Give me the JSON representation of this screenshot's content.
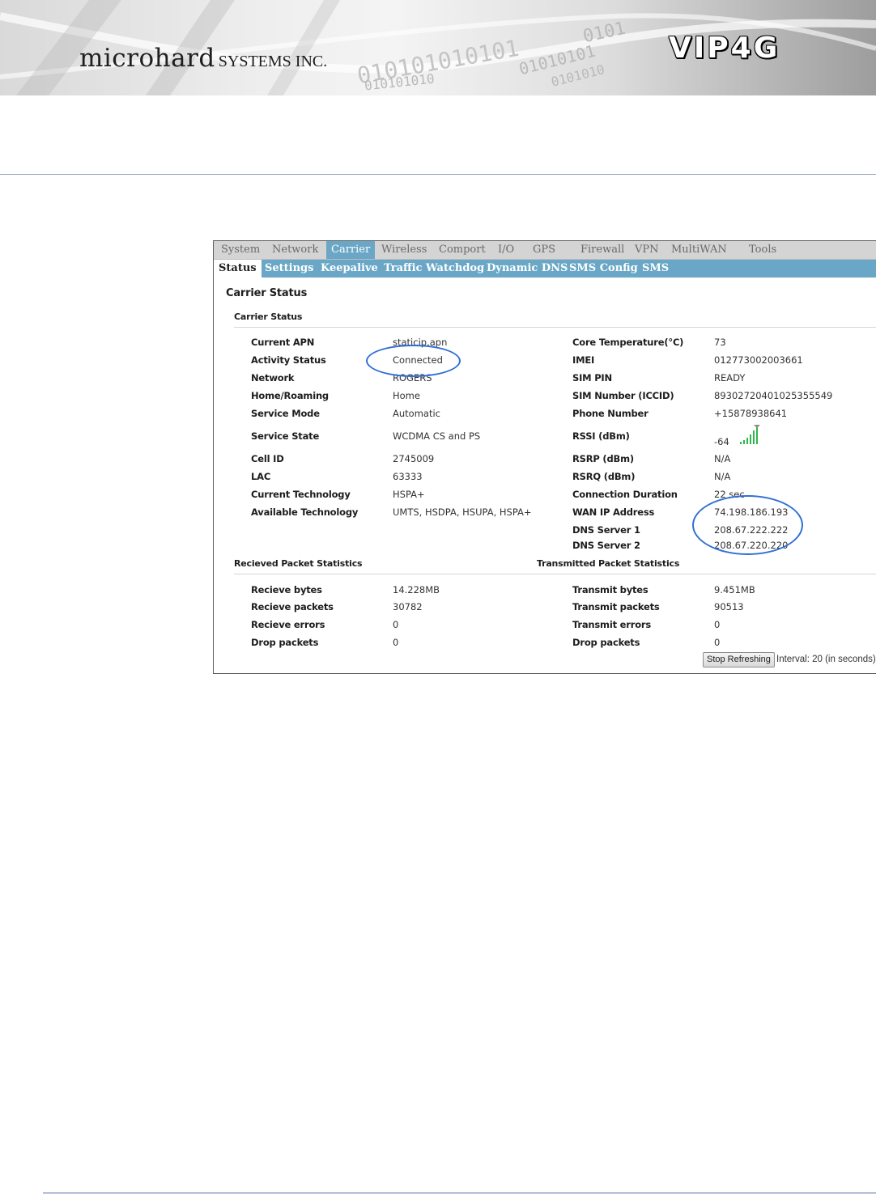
{
  "banner": {
    "company_name": "microhard",
    "company_suffix": "SYSTEMS INC.",
    "product": "VIP4G",
    "binary_lines": [
      "0101",
      "010101010101",
      "01010101",
      "0101010",
      "010101010"
    ]
  },
  "tabs": {
    "main": [
      {
        "label": "System"
      },
      {
        "label": "Network"
      },
      {
        "label": "Carrier",
        "active": true
      },
      {
        "label": "Wireless"
      },
      {
        "label": "Comport"
      },
      {
        "label": "I/O"
      },
      {
        "label": "GPS"
      },
      {
        "label": "Firewall"
      },
      {
        "label": "VPN"
      },
      {
        "label": "MultiWAN"
      },
      {
        "label": "Tools"
      }
    ],
    "sub": [
      {
        "label": "Status",
        "active": true
      },
      {
        "label": "Settings"
      },
      {
        "label": "Keepalive"
      },
      {
        "label": "Traffic Watchdog"
      },
      {
        "label": "Dynamic DNS"
      },
      {
        "label": "SMS Config"
      },
      {
        "label": "SMS"
      }
    ]
  },
  "status": {
    "title": "Carrier Status",
    "subtitle": "Carrier Status",
    "left": [
      {
        "label": "Current APN",
        "value": "staticip.apn"
      },
      {
        "label": "Activity Status",
        "value": "Connected"
      },
      {
        "label": "Network",
        "value": "ROGERS"
      },
      {
        "label": "Home/Roaming",
        "value": "Home"
      },
      {
        "label": "Service Mode",
        "value": "Automatic"
      },
      {
        "label": "Service State",
        "value": "WCDMA CS and PS"
      },
      {
        "label": "Cell ID",
        "value": "2745009"
      },
      {
        "label": "LAC",
        "value": "63333"
      },
      {
        "label": "Current Technology",
        "value": "HSPA+"
      },
      {
        "label": "Available Technology",
        "value": "UMTS, HSDPA, HSUPA, HSPA+"
      }
    ],
    "right": [
      {
        "label": "Core Temperature(°C)",
        "value": "73"
      },
      {
        "label": "IMEI",
        "value": "012773002003661"
      },
      {
        "label": "SIM PIN",
        "value": "READY"
      },
      {
        "label": "SIM Number (ICCID)",
        "value": "89302720401025355549"
      },
      {
        "label": "Phone Number",
        "value": "+15878938641"
      },
      {
        "label": "RSSI (dBm)",
        "value": "-64"
      },
      {
        "label": "RSRP (dBm)",
        "value": "N/A"
      },
      {
        "label": "RSRQ (dBm)",
        "value": "N/A"
      },
      {
        "label": "Connection Duration",
        "value": "22 sec"
      },
      {
        "label": "WAN IP Address",
        "value": "74.198.186.193"
      },
      {
        "label": "DNS Server 1",
        "value": "208.67.222.222"
      },
      {
        "label": "DNS Server 2",
        "value": "208.67.220.220"
      }
    ]
  },
  "received": {
    "title": "Recieved Packet Statistics",
    "rows": [
      {
        "label": "Recieve bytes",
        "value": "14.228MB"
      },
      {
        "label": "Recieve packets",
        "value": "30782"
      },
      {
        "label": "Recieve errors",
        "value": "0"
      },
      {
        "label": "Drop packets",
        "value": "0"
      }
    ]
  },
  "transmitted": {
    "title": "Transmitted Packet Statistics",
    "rows": [
      {
        "label": "Transmit bytes",
        "value": "9.451MB"
      },
      {
        "label": "Transmit packets",
        "value": "90513"
      },
      {
        "label": "Transmit errors",
        "value": "0"
      },
      {
        "label": "Drop packets",
        "value": "0"
      }
    ]
  },
  "refresh": {
    "button_label": "Stop Refreshing",
    "interval_text": "Interval: 20 (in seconds)"
  },
  "colors": {
    "tab_bar": "#d4d4d4",
    "accent": "#6aa7c6",
    "highlight_circle": "#2f6fd6",
    "signal": "#2fb84a"
  }
}
